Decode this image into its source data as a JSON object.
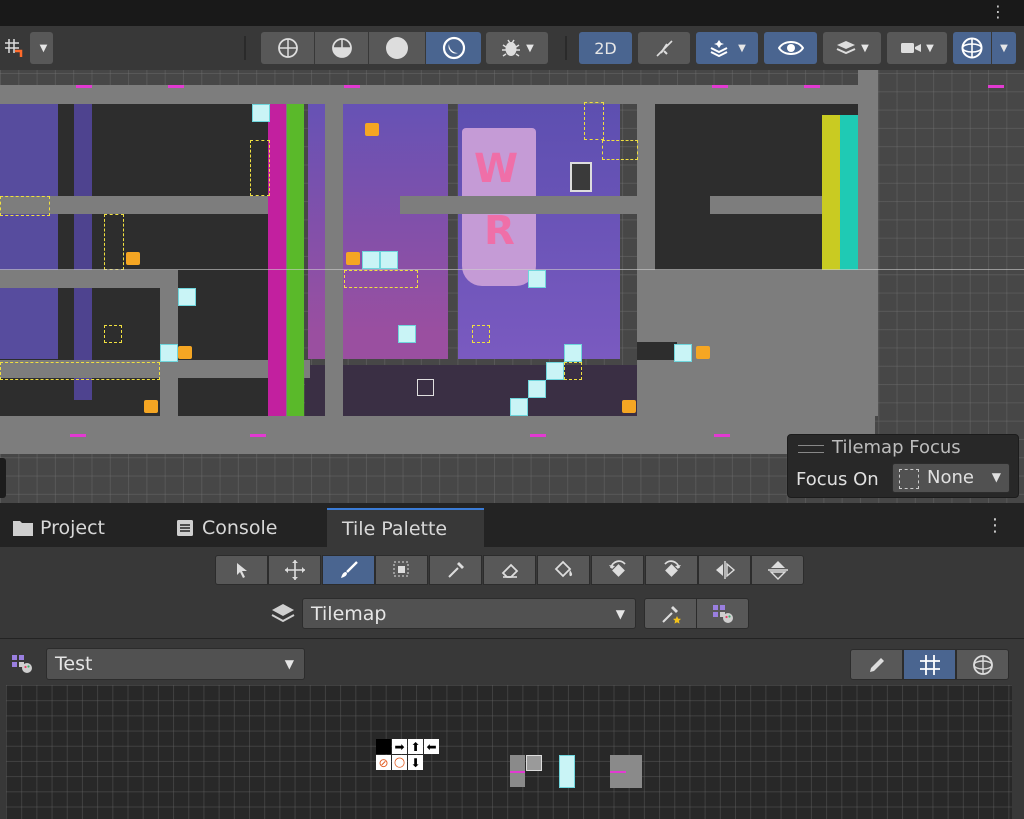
{
  "toolbar": {
    "mode_2d_label": "2D",
    "icons": [
      "grid-snap-icon",
      "shaded-sphere-icon",
      "wireframe-sphere-icon",
      "solid-sphere-icon",
      "unlit-sphere-icon",
      "debug-bug-icon",
      "2d-toggle",
      "light-toggle-icon",
      "fx-layers-icon",
      "visibility-eye-icon",
      "layers-icon",
      "camera-icon",
      "gizmos-icon"
    ]
  },
  "scene": {
    "letters": [
      "W",
      "R"
    ],
    "overlay": {
      "title": "Tilemap Focus",
      "focus_label": "Focus On",
      "focus_value": "None"
    }
  },
  "tabs": [
    {
      "label": "Project",
      "icon": "folder-icon"
    },
    {
      "label": "Console",
      "icon": "console-icon"
    },
    {
      "label": "Tile Palette",
      "icon": ""
    }
  ],
  "palette": {
    "tools": [
      "select-tool",
      "move-tool",
      "brush-tool",
      "box-fill-tool",
      "picker-tool",
      "eraser-tool",
      "fill-tool",
      "rotate-ccw-tool",
      "rotate-cw-tool",
      "flip-x-tool",
      "flip-y-tool"
    ],
    "active_tool": "brush-tool",
    "target_tilemap": "Tilemap",
    "palette_name": "Test",
    "edit_modes": [
      "edit-pencil-icon",
      "grid-icon",
      "gizmo-icon"
    ]
  },
  "colors": {
    "accent": "#4a6590",
    "tab_highlight": "#3a7bd5",
    "magenta_bar": "#c2209f",
    "green_bar": "#5ab92a",
    "yellow_bar": "#c9cb22",
    "teal_bar": "#1fcab4",
    "purple_bg": "#6f53b0"
  }
}
